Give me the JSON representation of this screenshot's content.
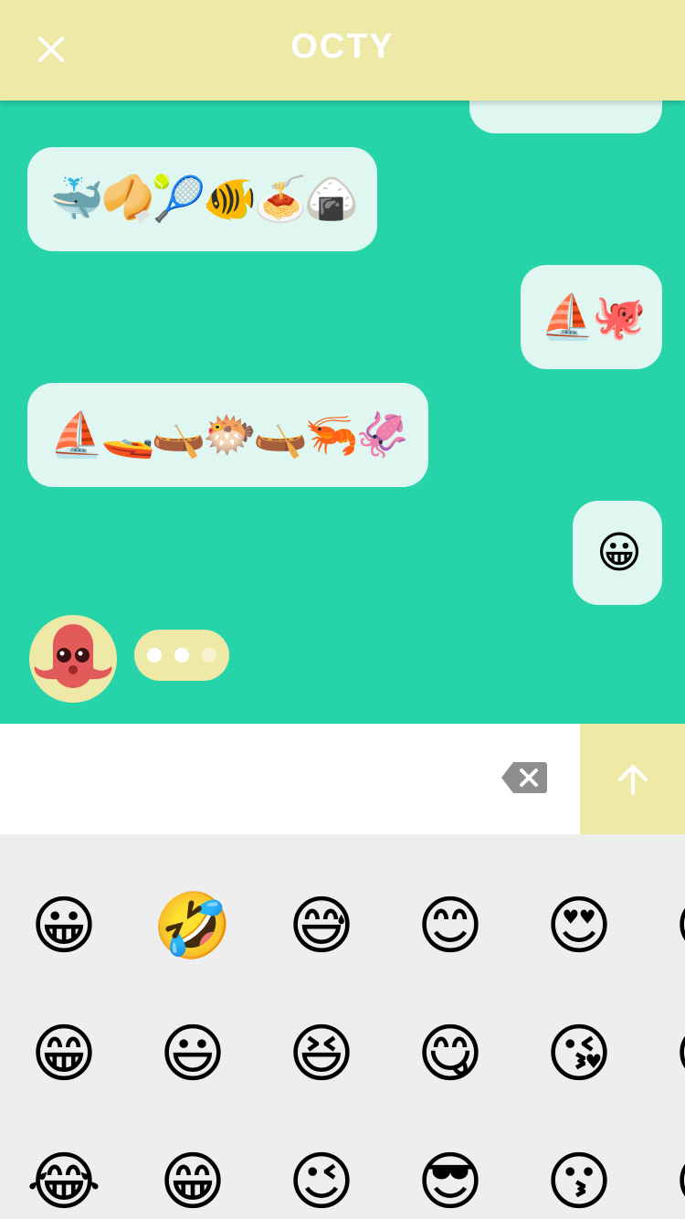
{
  "header": {
    "title": "OCTY",
    "close_icon": "close-icon"
  },
  "messages": [
    {
      "side": "right",
      "text": ""
    },
    {
      "side": "left",
      "text": "🐳🥠🎾🐠🍝🍙"
    },
    {
      "side": "right",
      "text": "⛵🐙"
    },
    {
      "side": "left",
      "text": "⛵🚤🛶🐡🛶🦐🦑"
    },
    {
      "side": "right",
      "text": "😀"
    }
  ],
  "composer": {
    "value": "",
    "backspace_icon": "backspace-icon",
    "send_icon": "arrow-up-icon"
  },
  "keyboard": {
    "rows": [
      [
        "😀",
        "🤣",
        "😅",
        "😊",
        "😍",
        "😘"
      ],
      [
        "😁",
        "😃",
        "😆",
        "😋",
        "😘",
        "😚"
      ],
      [
        "😂",
        "😁",
        "😉",
        "😎",
        "😗",
        "😙"
      ]
    ]
  },
  "colors": {
    "header": "#efe9a8",
    "chat_bg": "#27d4aa",
    "bubble": "#dff7f0",
    "keyboard_bg": "#eeeeee"
  }
}
